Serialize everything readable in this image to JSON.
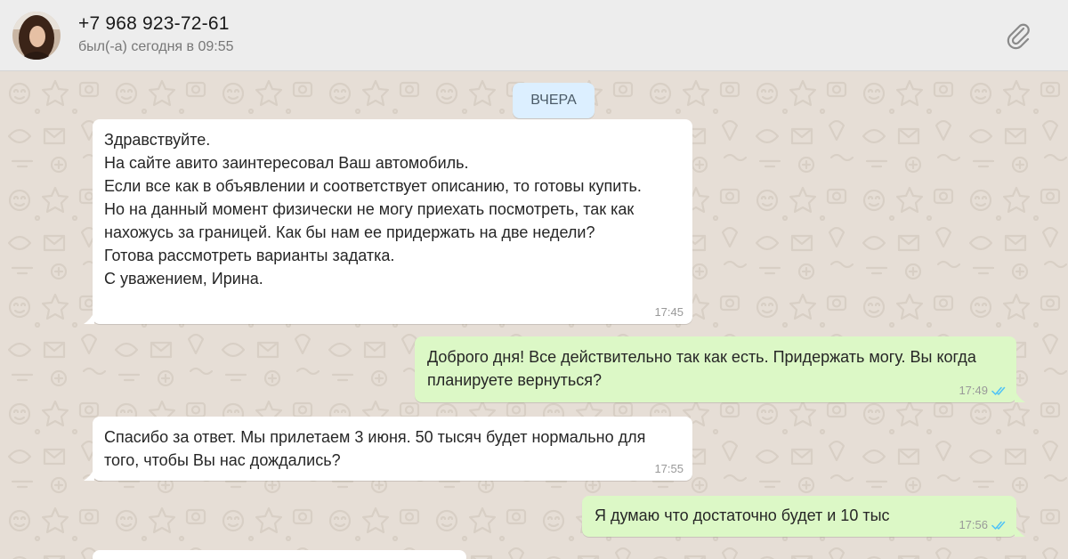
{
  "header": {
    "contact_name": "+7 968 923-72-61",
    "last_seen": "был(-а) сегодня в 09:55",
    "avatar_icon": "contact-avatar",
    "attach_icon": "paperclip-icon"
  },
  "chat": {
    "date_divider": "ВЧЕРА",
    "messages": [
      {
        "direction": "incoming",
        "text": "Здравствуйте.\nНа сайте авито заинтересовал Ваш автомобиль.\nЕсли все как в объявлении и соответствует описанию,  то готовы купить.\nНо на данный момент физически не могу приехать посмотреть,  так как нахожусь за границей.  Как бы нам ее придержать на две недели?\nГотова рассмотреть варианты задатка.\nС уважением,  Ирина.",
        "time": "17:45"
      },
      {
        "direction": "outgoing",
        "text": "Доброго дня! Все действительно так как есть. Придержать могу. Вы когда планируете вернуться?",
        "time": "17:49",
        "status_icon": "double-check-read-icon"
      },
      {
        "direction": "incoming",
        "text": "Спасибо за ответ. Мы прилетаем 3 июня.  50 тысяч будет нормально для того, чтобы Вы нас дождались?",
        "time": "17:55"
      },
      {
        "direction": "outgoing",
        "text": "Я думаю что достаточно будет и 10 тыс",
        "time": "17:56",
        "status_icon": "double-check-read-icon"
      },
      {
        "direction": "incoming",
        "text": "",
        "time": ""
      }
    ]
  },
  "colors": {
    "header_bg": "#ededed",
    "chat_bg": "#e6ded6",
    "incoming_bubble": "#ffffff",
    "outgoing_bubble": "#dcf8c6",
    "date_pill": "#dcefff",
    "read_ticks": "#4fc3f7"
  }
}
